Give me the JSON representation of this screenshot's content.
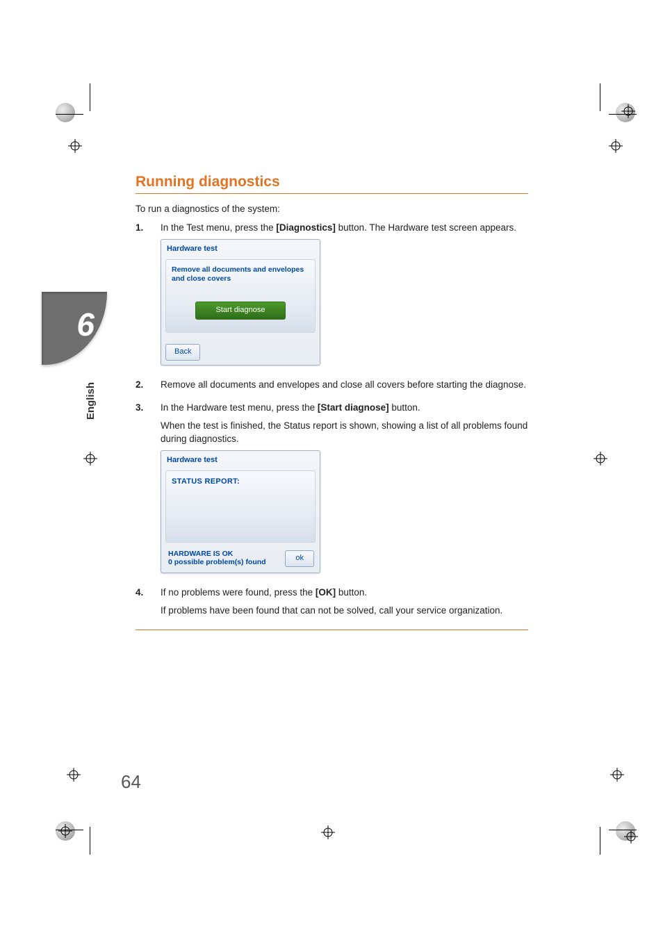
{
  "side_tab": {
    "chapter": "6",
    "language": "English"
  },
  "page_number": "64",
  "heading": "Running diagnostics",
  "lead": "To run a diagnostics of the system:",
  "steps": [
    {
      "num": "1.",
      "text_before": "In the Test menu, press the ",
      "bold": "[Diagnostics]",
      "text_after": " button. The Hardware test screen appears."
    },
    {
      "num": "2.",
      "text_before": "Remove all documents and envelopes and close all covers before starting the diagnose.",
      "bold": "",
      "text_after": ""
    },
    {
      "num": "3.",
      "text_before": "In the Hardware test menu, press the ",
      "bold": "[Start diagnose]",
      "text_after": " button.",
      "line2": "When the test is finished, the Status report is shown, showing a list of all problems found during diagnostics."
    },
    {
      "num": "4.",
      "text_before": "If no problems were found, press the ",
      "bold": "[OK]",
      "text_after": " button.",
      "line2": "If problems have been found that can not be solved, call your service organization."
    }
  ],
  "screenshot1": {
    "title": "Hardware test",
    "instr_line1": "Remove all documents and envelopes",
    "instr_line2": "and close covers",
    "start_button": "Start diagnose",
    "back_button": "Back"
  },
  "screenshot2": {
    "title": "Hardware test",
    "status_label": "STATUS REPORT:",
    "footer_line1": "HARDWARE IS OK",
    "footer_line2": "0 possible problem(s) found",
    "ok_button": "ok"
  }
}
